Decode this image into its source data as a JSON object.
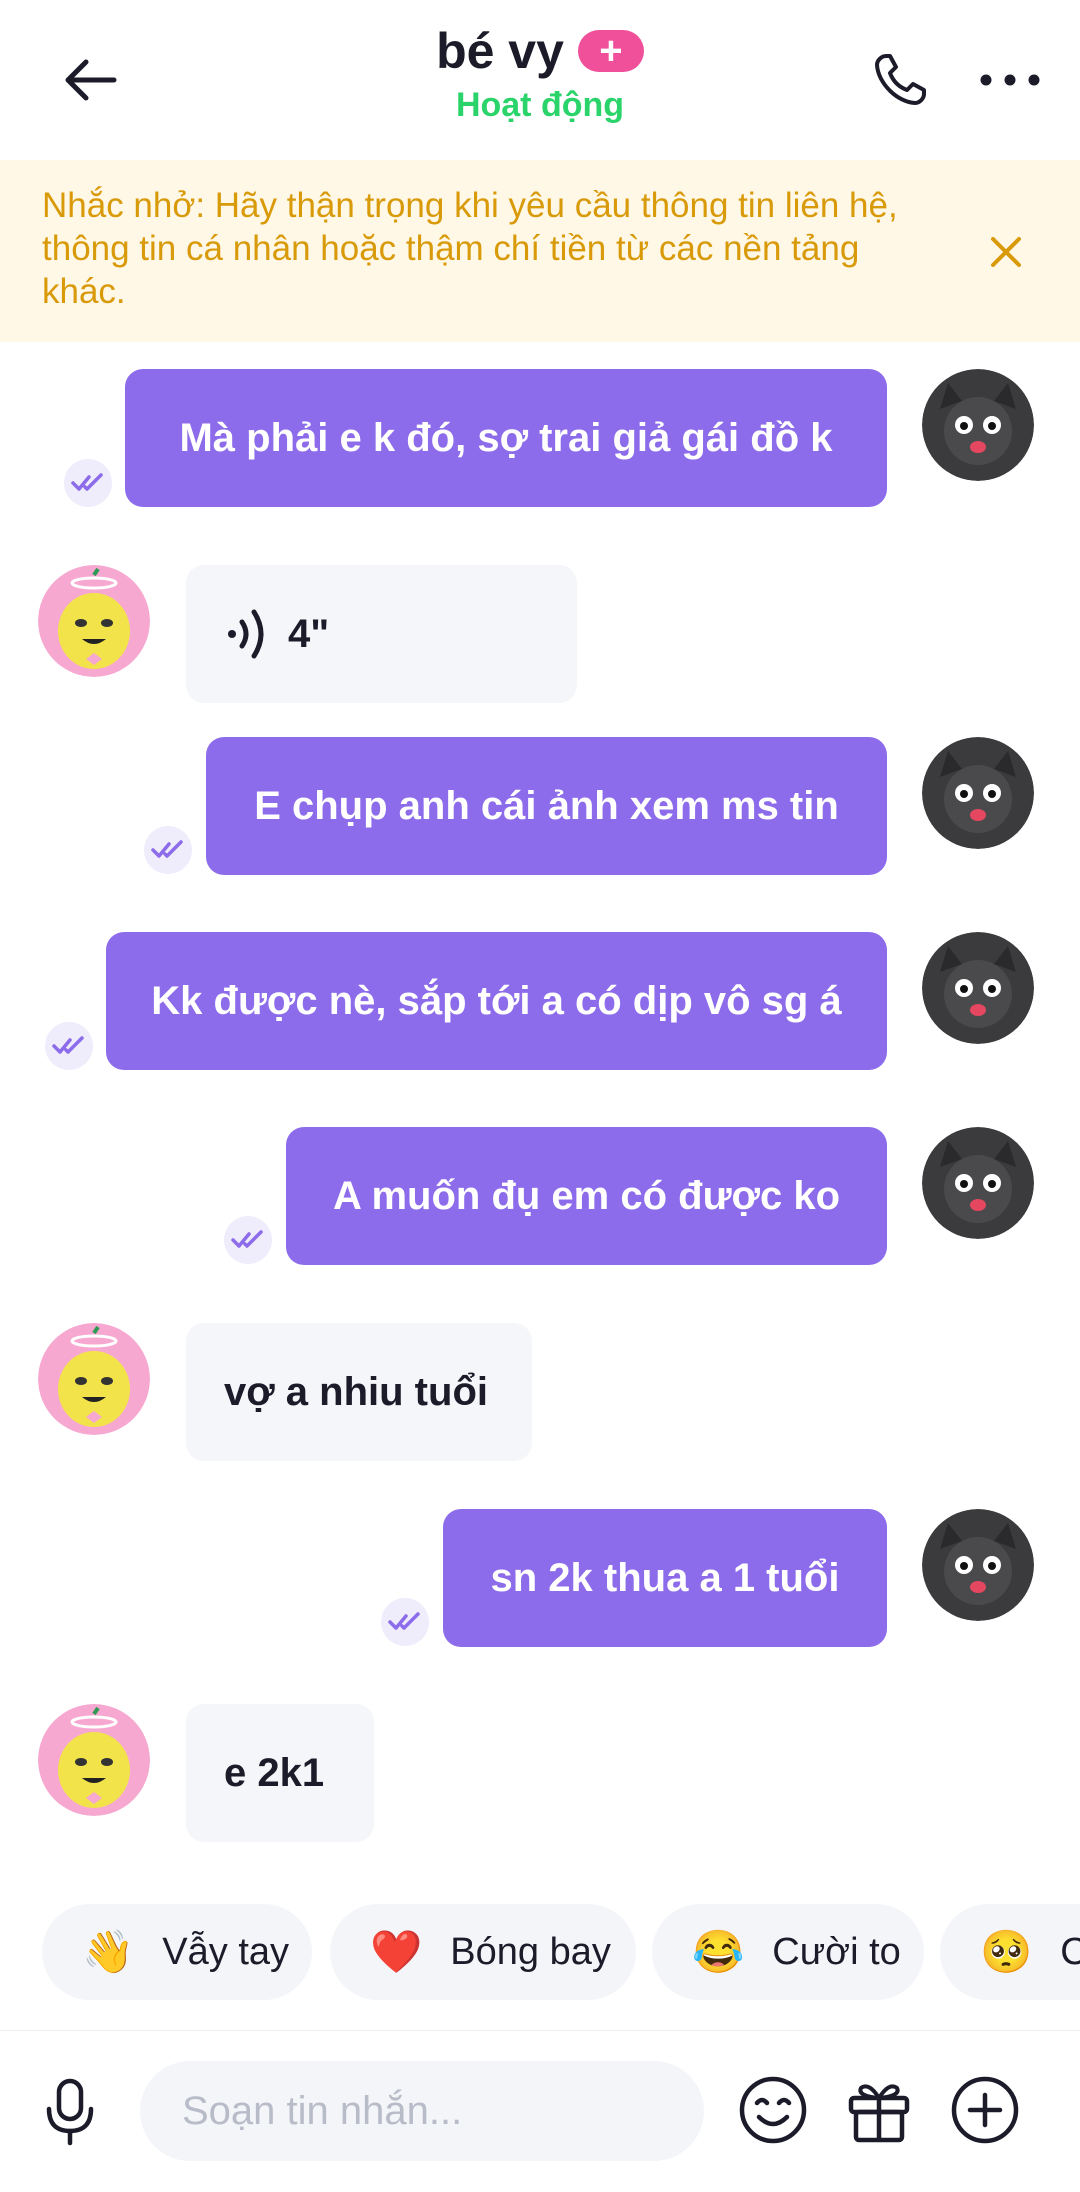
{
  "header": {
    "back_icon": "arrow-left-icon",
    "title": "bé vy",
    "badge": "+",
    "status": "Hoạt động",
    "status_color": "#2ad46a",
    "call_icon": "phone-icon",
    "more_icon": "more-horizontal-icon"
  },
  "warning": {
    "text": "Nhắc nhở: Hãy thận trọng khi yêu cầu thông tin liên hệ, thông tin cá nhân hoặc thậm chí tiền từ các nền tảng khác.",
    "close_icon": "close-icon"
  },
  "messages": [
    {
      "direction": "out",
      "text": "Mà phải e k đó, sợ trai giả gái đồ k",
      "seen": true
    },
    {
      "direction": "in",
      "type": "voice",
      "duration": "4\""
    },
    {
      "direction": "out",
      "text": "E chụp anh cái ảnh xem ms tin",
      "seen": true
    },
    {
      "direction": "out",
      "text": "Kk được nè, sắp tới a có dịp vô sg á",
      "seen": true
    },
    {
      "direction": "out",
      "text": "A muốn đụ em có được ko",
      "seen": true
    },
    {
      "direction": "in",
      "text": "vợ a nhiu tuổi"
    },
    {
      "direction": "out",
      "text": "sn 2k thua a 1 tuổi",
      "seen": true
    },
    {
      "direction": "in",
      "text": "e 2k1"
    }
  ],
  "quick_reactions": [
    {
      "emoji": "👋",
      "label": "Vẫy tay"
    },
    {
      "emoji": "❤️",
      "label": "Bóng bay"
    },
    {
      "emoji": "😂",
      "label": "Cười to"
    },
    {
      "emoji": "🥺",
      "label": "C"
    }
  ],
  "composer": {
    "placeholder": "Soạn tin nhắn...",
    "mic_icon": "microphone-icon",
    "emoji_icon": "smiley-icon",
    "gift_icon": "gift-icon",
    "add_icon": "plus-circle-icon"
  },
  "colors": {
    "outgoing_bubble": "#8c6cea",
    "incoming_bubble": "#f5f6f9",
    "warning_bg": "#fff8e6",
    "warning_text": "#d99a0a",
    "badge": "#f0509a"
  }
}
